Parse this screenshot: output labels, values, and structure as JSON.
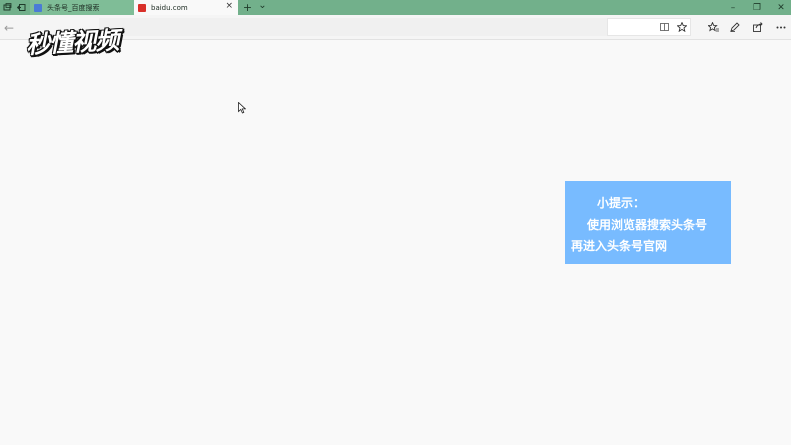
{
  "tabs": [
    {
      "label": "头条号_百度搜索",
      "active": false,
      "favicon": "baidu-paw-icon"
    },
    {
      "label": "baidu.com",
      "active": true,
      "favicon": "baidu-du-icon",
      "close_glyph": "×"
    }
  ],
  "titlebar": {
    "left_icons": [
      "tab-manage-icon",
      "tab-back-icon"
    ],
    "new_tab_glyph": "+",
    "dropdown_glyph": "⌄",
    "window_controls": {
      "minimize": "–",
      "restore": "❐",
      "close": "✕"
    }
  },
  "toolbar": {
    "back_glyph": "←",
    "icons": [
      "reading-view-icon",
      "favorite-star-icon",
      "favorites-hub-icon",
      "web-note-icon",
      "share-icon",
      "more-icon"
    ]
  },
  "watermark": {
    "text": "秒懂视频"
  },
  "tip": {
    "line1": "小提示：",
    "line2": "使用浏览器搜索头条号",
    "line3": "再进入头条号官网"
  },
  "colors": {
    "titlebar": "#72b08b",
    "tip_background": "#78bbff",
    "page_background": "#f9f9f9"
  }
}
